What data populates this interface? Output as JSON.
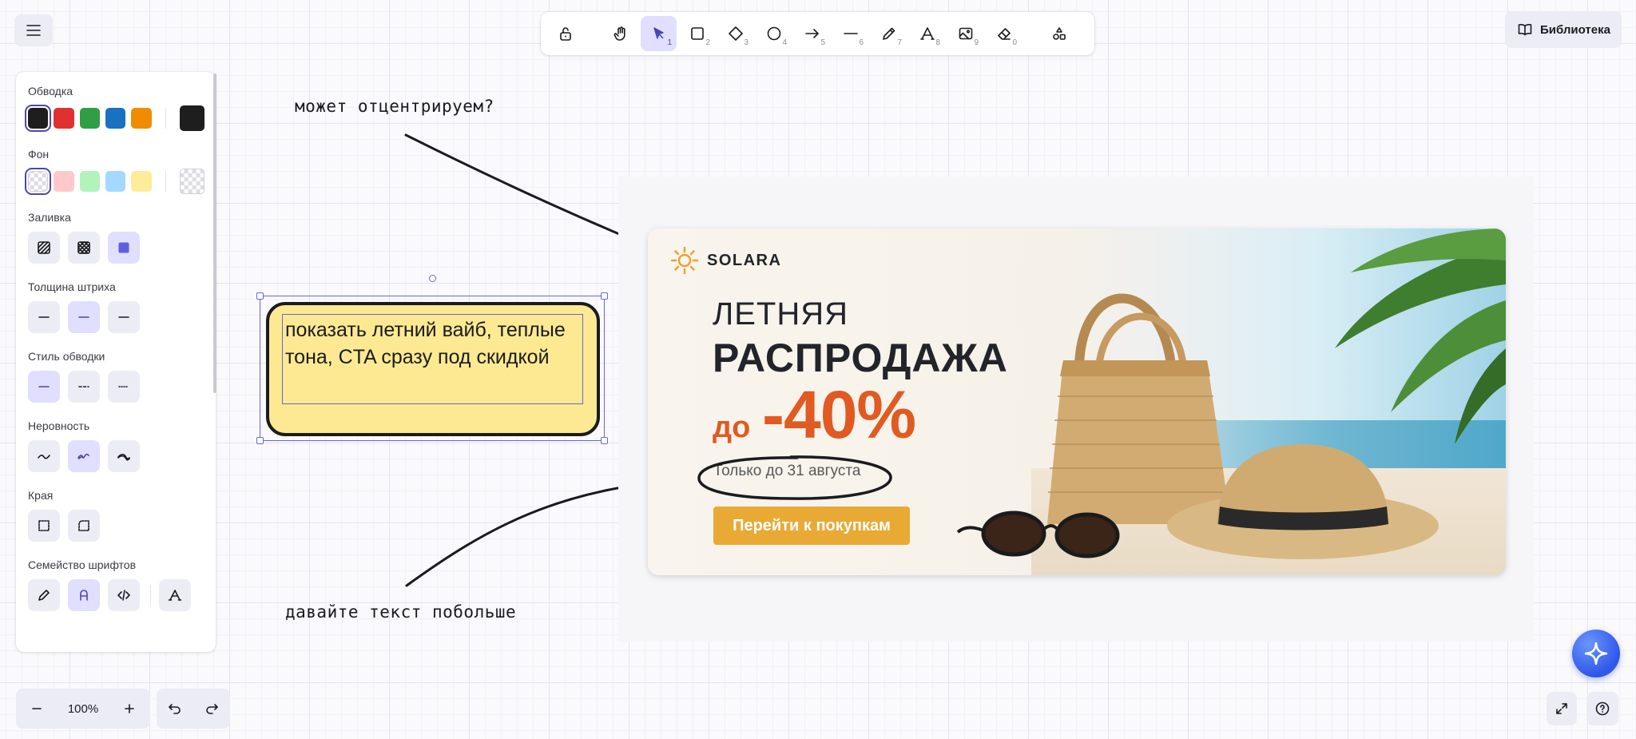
{
  "toolbar": {
    "tools": [
      {
        "name": "lock",
        "key": ""
      },
      {
        "name": "hand",
        "key": ""
      },
      {
        "name": "selection",
        "key": "1"
      },
      {
        "name": "rectangle",
        "key": "2"
      },
      {
        "name": "diamond",
        "key": "3"
      },
      {
        "name": "ellipse",
        "key": "4"
      },
      {
        "name": "arrow",
        "key": "5"
      },
      {
        "name": "line",
        "key": "6"
      },
      {
        "name": "draw",
        "key": "7"
      },
      {
        "name": "text",
        "key": "8"
      },
      {
        "name": "image",
        "key": "9"
      },
      {
        "name": "eraser",
        "key": "0"
      },
      {
        "name": "more-tools",
        "key": ""
      }
    ],
    "selected_tool": "selection",
    "accent_color": "#4a47b1"
  },
  "library": {
    "label": "Библиотека"
  },
  "panel": {
    "stroke_label": "Обводка",
    "stroke_colors": [
      "#1e1e1e",
      "#e03131",
      "#2f9e44",
      "#1971c2",
      "#f08c00"
    ],
    "stroke_current": "#1e1e1e",
    "background_label": "Фон",
    "background_colors": [
      "transparent",
      "#ffc9c9",
      "#b2f2bb",
      "#a5d8ff",
      "#ffec99"
    ],
    "background_current": "transparent",
    "fill_label": "Заливка",
    "stroke_width_label": "Толщина штриха",
    "stroke_style_label": "Стиль обводки",
    "sloppiness_label": "Неровность",
    "edges_label": "Края",
    "font_family_label": "Семейство шрифтов"
  },
  "zoom": {
    "value": "100%"
  },
  "canvas": {
    "annotation_top": "может отцентрируем?",
    "annotation_bottom": "давайте текст побольше",
    "note_text": "показать летний вайб, теплые тона, CTA сразу под скидкой",
    "note_color": "#fce991"
  },
  "banner": {
    "brand": "SOLARA",
    "line1": "ЛЕТНЯЯ",
    "line2": "РАСПРОДАЖА",
    "prefix": "до",
    "discount": "-40%",
    "deadline": "Только до 31 августа",
    "cta": "Перейти к покупкам",
    "accent_color": "#e05a22",
    "cta_color": "#e9a935"
  }
}
